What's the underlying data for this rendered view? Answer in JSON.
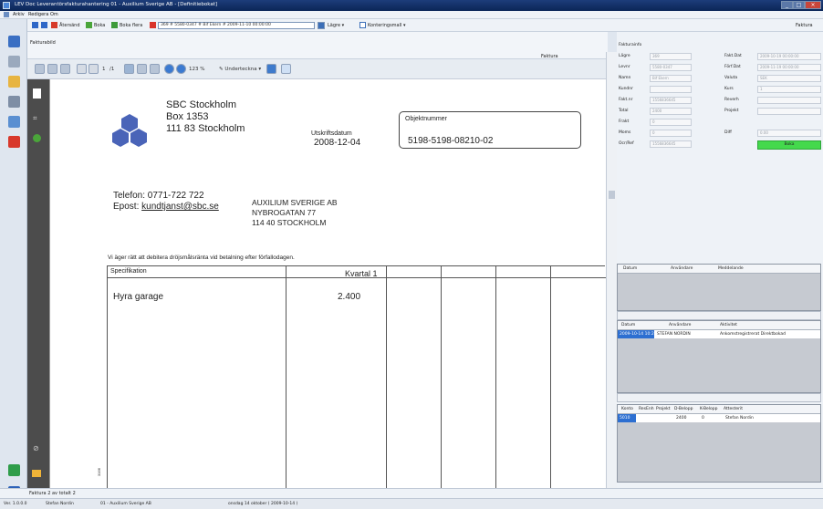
{
  "window": {
    "title": "LEV Doc  Leverantörsfakturahantering  01 - Auxilium Sverige AB - [Definitiebokat]"
  },
  "menu": [
    "Arkiv",
    "Redigera",
    "Om"
  ],
  "toolbar": {
    "aterstand": "Återsänd",
    "boka": "Boka",
    "boka_flera": "Boka flera",
    "record_select": "369 # 5580-0347 # Bif Ekern # 2009-11-10 00:00:00",
    "lagre": "Lägre",
    "konteringsmall": "Konteringsmall",
    "faktura_right": "Faktura"
  },
  "panel": {
    "fakturabild": "Fakturabild",
    "faktura_tab": "Faktura"
  },
  "viewer": {
    "page": "1",
    "page_total": "/1",
    "zoom": "123 %",
    "underteckna": "Underteckna"
  },
  "document": {
    "sender_name": "SBC Stockholm",
    "sender_box": "Box 1353",
    "sender_city": "111 83 Stockholm",
    "date_label": "Utskriftsdatum",
    "date_value": "2008-12-04",
    "obj_label": "Objektnummer",
    "obj_value": "5198-5198-08210-02",
    "phone": "Telefon: 0771-722 722",
    "email_label": "Epost: ",
    "email": "kundtjanst@sbc.se",
    "recipient_1": "AUXILIUM SVERIGE AB",
    "recipient_2": "NYBROGATAN 77",
    "recipient_3": "114 40 STOCKHOLM",
    "notice": "Vi äger rätt att debitera dröjsmålsränta vid betalning efter förfallodagen.",
    "spec_label": "Specifikation",
    "col_quarter": "Kvartal 1",
    "row_item": "Hyra garage",
    "row_value": "2.400",
    "margin_code": "3166"
  },
  "fakturainfo": {
    "title": "Fakturainfo",
    "left_labels": [
      "Lägre",
      "Levnr",
      "Namn",
      "Kundnr",
      "Fakt.nr",
      "Total",
      "Frakt",
      "Moms",
      "Ocr/Ref"
    ],
    "left_values": [
      "369",
      "5580-0347",
      "Bif Ekern",
      "",
      "1556836645",
      "2400",
      "0",
      "0",
      "1556836645"
    ],
    "right_labels": [
      "Fakt.Dat",
      "Förf.Dat",
      "Valuta",
      "Kurs",
      "Reverh",
      "Projekt",
      "",
      "Diff"
    ],
    "right_values": [
      "2009-10-19 00:00:00",
      "2009-11-19 00:00:00",
      "SEK",
      "1",
      "",
      "",
      "",
      "0.00"
    ],
    "status": "Boka"
  },
  "grid1": {
    "cols": [
      "Datum",
      "Användare",
      "Meddelande"
    ]
  },
  "grid2": {
    "cols": [
      "Datum",
      "Användare",
      "Aktivitet"
    ],
    "row": [
      "2009-10-14 10:23",
      "STEFAN NORDIN",
      "Ankomstregistrerat Direktbokad"
    ]
  },
  "grid3": {
    "cols": [
      "Konto",
      "ResEnh",
      "Projekt",
      "D-Belopp",
      "K-Belopp",
      "Attesterit"
    ],
    "row": [
      "5010",
      "",
      "",
      "2400",
      "0",
      "Stefan Nordin"
    ]
  },
  "status": {
    "line1": "Faktura 2 av totalt 2",
    "version": "Ver. 1.0.0.0",
    "user": "Stefan Nordin",
    "company": "01 - Auxilium Sverige AB",
    "date": "onsdag 14 oktober ( 2009-10-14 )"
  },
  "colors": {
    "accent": "#1d3d7a",
    "status_green": "#44d94c",
    "selection": "#2d6fd1"
  }
}
